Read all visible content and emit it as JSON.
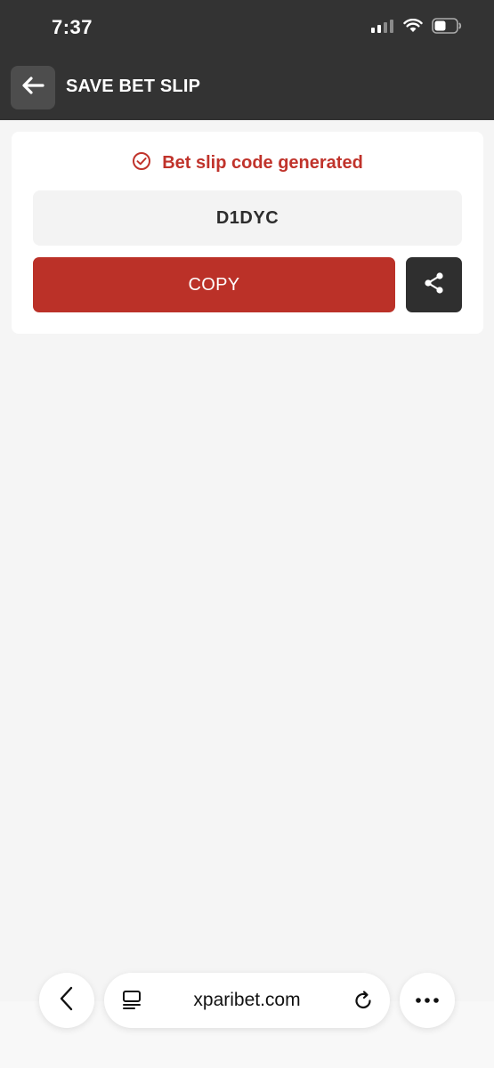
{
  "status_bar": {
    "time": "7:37",
    "icons": [
      "signal-icon",
      "wifi-icon",
      "battery-icon"
    ]
  },
  "header": {
    "title": "SAVE BET SLIP",
    "back_icon": "arrow-left-icon"
  },
  "card": {
    "success_message": "Bet slip code generated",
    "success_icon": "check-circle-icon",
    "code": "D1DYC",
    "copy_label": "COPY",
    "share_icon": "share-icon"
  },
  "browser": {
    "url": "xparibet.com",
    "back_icon": "chevron-left-icon",
    "reader_icon": "reader-icon",
    "reload_icon": "reload-icon",
    "more_icon": "more-icon"
  },
  "colors": {
    "accent": "#bb3128",
    "header_bg": "#333333",
    "page_bg": "#f5f5f5"
  }
}
